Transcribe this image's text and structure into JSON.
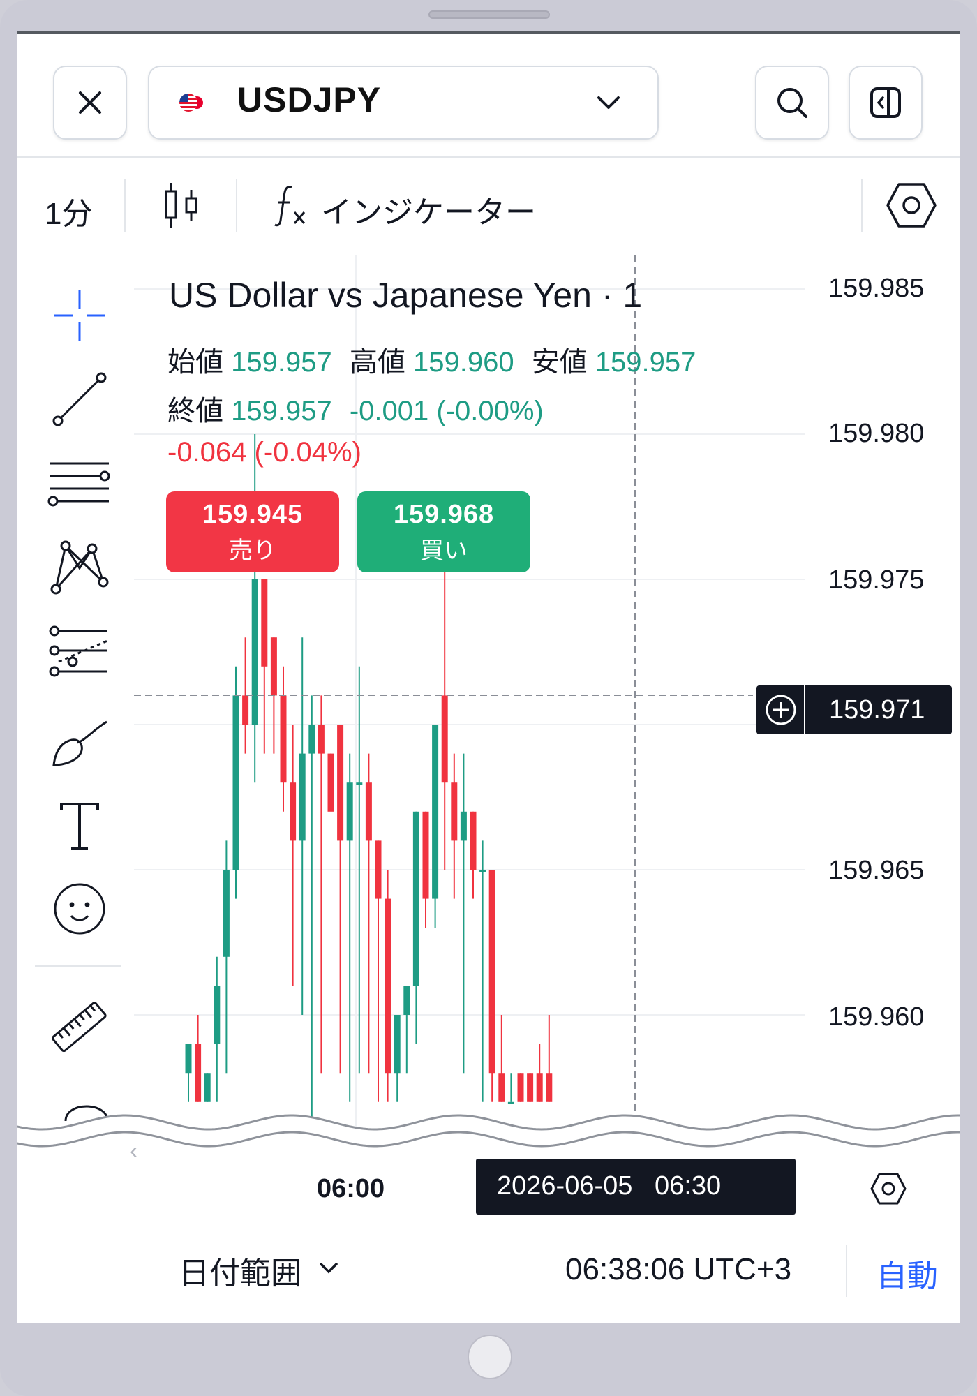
{
  "header": {
    "symbol": "USDJPY",
    "close_icon": "close-icon",
    "search_icon": "search-icon",
    "panel_icon": "panel-toggle-icon"
  },
  "toolbar": {
    "interval": "1分",
    "chart_type_icon": "candlestick-icon",
    "indicators_label": "インジケーター",
    "settings_icon": "hexagon-settings-icon"
  },
  "drawing_tools": [
    "crosshair-icon",
    "trend-line-icon",
    "horizontal-lines-icon",
    "pattern-icon",
    "fib-icon",
    "brush-icon",
    "text-icon",
    "emoji-icon",
    "ruler-icon"
  ],
  "legend": {
    "title": "US Dollar vs Japanese Yen · 1",
    "open_label": "始値",
    "open": "159.957",
    "high_label": "高値",
    "high": "159.960",
    "low_label": "安値",
    "low": "159.957",
    "close_label": "終値",
    "close": "159.957",
    "bar_change": "-0.001 (-0.00%)",
    "day_change": "-0.064 (-0.04%)"
  },
  "trade": {
    "sell_price": "159.945",
    "sell_label": "売り",
    "buy_price": "159.968",
    "buy_label": "買い"
  },
  "price_axis": {
    "labels": [
      "159.985",
      "159.980",
      "159.975",
      "159.970",
      "159.965",
      "159.960"
    ],
    "crosshair_price": "159.971"
  },
  "time_axis": {
    "label": "06:00",
    "crosshair_time": "2026-06-05   06:30"
  },
  "footer": {
    "date_range": "日付範囲",
    "clock": "06:38:06 UTC+3",
    "auto": "自動"
  },
  "colors": {
    "up": "#1e9c84",
    "down": "#f0333f",
    "accent": "#2962ff"
  },
  "chart_data": {
    "type": "candlestick",
    "interval": "1分",
    "ylim": [
      159.957,
      159.987
    ],
    "candles": [
      {
        "o": 159.958,
        "h": 159.959,
        "l": 159.957,
        "c": 159.959
      },
      {
        "o": 159.959,
        "h": 159.96,
        "l": 159.957,
        "c": 159.957
      },
      {
        "o": 159.957,
        "h": 159.958,
        "l": 159.957,
        "c": 159.958
      },
      {
        "o": 159.959,
        "h": 159.962,
        "l": 159.957,
        "c": 159.961
      },
      {
        "o": 159.962,
        "h": 159.966,
        "l": 159.958,
        "c": 159.965
      },
      {
        "o": 159.965,
        "h": 159.972,
        "l": 159.964,
        "c": 159.971
      },
      {
        "o": 159.971,
        "h": 159.973,
        "l": 159.969,
        "c": 159.97
      },
      {
        "o": 159.97,
        "h": 159.98,
        "l": 159.968,
        "c": 159.975
      },
      {
        "o": 159.975,
        "h": 159.975,
        "l": 159.969,
        "c": 159.972
      },
      {
        "o": 159.973,
        "h": 159.973,
        "l": 159.969,
        "c": 159.971
      },
      {
        "o": 159.971,
        "h": 159.972,
        "l": 159.967,
        "c": 159.968
      },
      {
        "o": 159.968,
        "h": 159.97,
        "l": 159.961,
        "c": 159.966
      },
      {
        "o": 159.966,
        "h": 159.973,
        "l": 159.96,
        "c": 159.969
      },
      {
        "o": 159.969,
        "h": 159.971,
        "l": 159.956,
        "c": 159.97
      },
      {
        "o": 159.97,
        "h": 159.971,
        "l": 159.958,
        "c": 159.969
      },
      {
        "o": 159.969,
        "h": 159.969,
        "l": 159.968,
        "c": 159.967
      },
      {
        "o": 159.97,
        "h": 159.97,
        "l": 159.958,
        "c": 159.966
      },
      {
        "o": 159.966,
        "h": 159.969,
        "l": 159.957,
        "c": 159.968
      },
      {
        "o": 159.968,
        "h": 159.972,
        "l": 159.958,
        "c": 159.968
      },
      {
        "o": 159.968,
        "h": 159.969,
        "l": 159.958,
        "c": 159.966
      },
      {
        "o": 159.966,
        "h": 159.966,
        "l": 159.957,
        "c": 159.964
      },
      {
        "o": 159.964,
        "h": 159.965,
        "l": 159.957,
        "c": 159.958
      },
      {
        "o": 159.958,
        "h": 159.96,
        "l": 159.957,
        "c": 159.96
      },
      {
        "o": 159.96,
        "h": 159.961,
        "l": 159.958,
        "c": 159.961
      },
      {
        "o": 159.961,
        "h": 159.967,
        "l": 159.959,
        "c": 159.967
      },
      {
        "o": 159.967,
        "h": 159.967,
        "l": 159.963,
        "c": 159.964
      },
      {
        "o": 159.964,
        "h": 159.97,
        "l": 159.963,
        "c": 159.97
      },
      {
        "o": 159.971,
        "h": 159.976,
        "l": 159.965,
        "c": 159.968
      },
      {
        "o": 159.968,
        "h": 159.969,
        "l": 159.964,
        "c": 159.966
      },
      {
        "o": 159.966,
        "h": 159.969,
        "l": 159.958,
        "c": 159.967
      },
      {
        "o": 159.967,
        "h": 159.967,
        "l": 159.964,
        "c": 159.965
      },
      {
        "o": 159.965,
        "h": 159.966,
        "l": 159.957,
        "c": 159.965
      },
      {
        "o": 159.965,
        "h": 159.965,
        "l": 159.957,
        "c": 159.958
      },
      {
        "o": 159.958,
        "h": 159.96,
        "l": 159.957,
        "c": 159.957
      },
      {
        "o": 159.957,
        "h": 159.958,
        "l": 159.957,
        "c": 159.957
      },
      {
        "o": 159.958,
        "h": 159.958,
        "l": 159.957,
        "c": 159.957
      },
      {
        "o": 159.958,
        "h": 159.958,
        "l": 159.957,
        "c": 159.957
      },
      {
        "o": 159.958,
        "h": 159.959,
        "l": 159.957,
        "c": 159.957
      },
      {
        "o": 159.958,
        "h": 159.96,
        "l": 159.957,
        "c": 159.957
      }
    ]
  }
}
